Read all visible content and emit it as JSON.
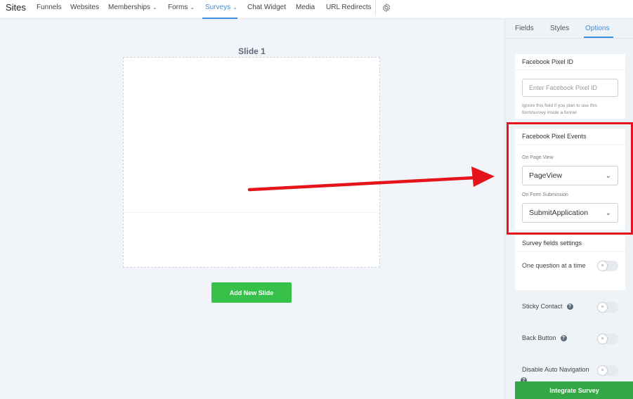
{
  "nav": {
    "brand": "Sites",
    "items": [
      {
        "label": "Funnels",
        "chevron": false,
        "active": false
      },
      {
        "label": "Websites",
        "chevron": false,
        "active": false
      },
      {
        "label": "Memberships",
        "chevron": true,
        "active": false
      },
      {
        "label": "Forms",
        "chevron": true,
        "active": false
      },
      {
        "label": "Surveys",
        "chevron": true,
        "active": true
      },
      {
        "label": "Chat Widget",
        "chevron": false,
        "active": false
      },
      {
        "label": "Media",
        "chevron": false,
        "active": false
      },
      {
        "label": "URL Redirects",
        "chevron": false,
        "active": false
      }
    ],
    "settings_icon": "gear-icon"
  },
  "canvas": {
    "slide_title": "Slide 1",
    "add_slide_label": "Add New Slide"
  },
  "panel": {
    "tabs": [
      {
        "label": "Fields",
        "active": false
      },
      {
        "label": "Styles",
        "active": false
      },
      {
        "label": "Options",
        "active": true
      }
    ],
    "pixel_id": {
      "heading": "Facebook Pixel ID",
      "placeholder": "Enter Facebook Pixel ID",
      "hint": "Ignore this field if you plan to use this form/survey inside a funnel"
    },
    "pixel_events": {
      "heading": "Facebook Pixel Events",
      "page_view_label": "On Page View",
      "page_view_value": "PageView",
      "form_submission_label": "On Form Submission",
      "form_submission_value": "SubmitApplication"
    },
    "survey_settings": {
      "heading": "Survey fields settings",
      "one_question_label": "One question at a time"
    },
    "sticky_contact_label": "Sticky Contact",
    "back_button_label": "Back Button",
    "disable_auto_nav_label": "Disable Auto Navigation",
    "toggle_off_glyph": "×",
    "help_glyph": "?",
    "integrate_label": "Integrate Survey"
  },
  "colors": {
    "accent": "#3b8ede",
    "green": "#37c14a",
    "annotation_red": "#e5131b"
  }
}
